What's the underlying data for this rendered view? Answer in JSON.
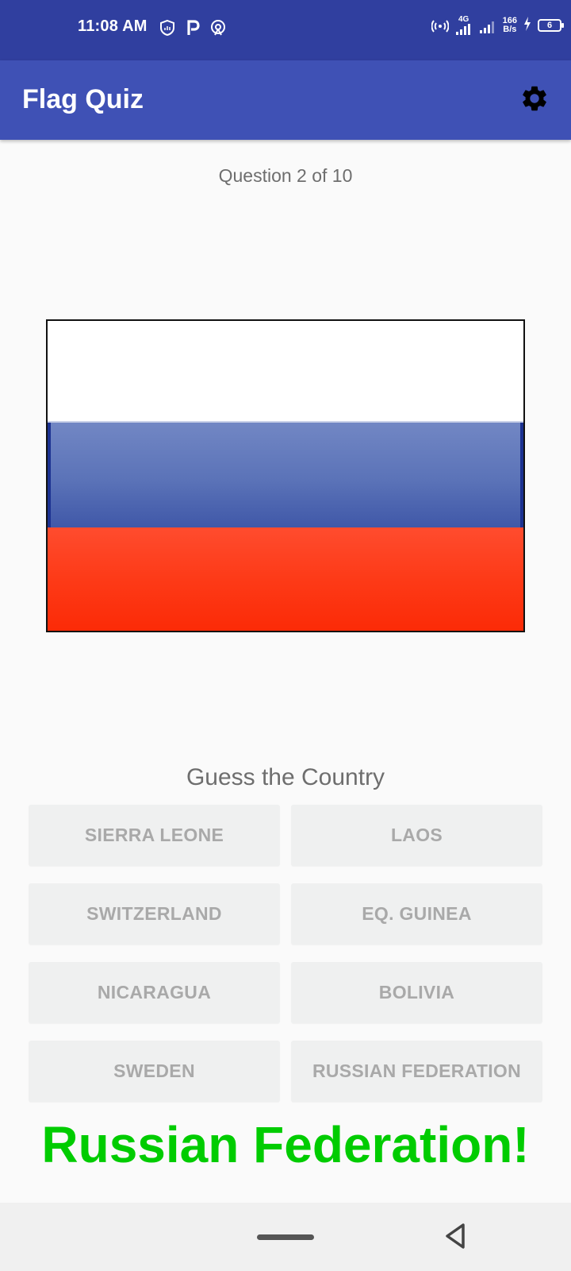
{
  "status_bar": {
    "time": "11:08 AM",
    "network_type": "4G",
    "speed_value": "166",
    "speed_unit": "B/s",
    "battery": "6",
    "icons": [
      "shield-icon",
      "p-icon",
      "hotspot-icon",
      "wifi-calling-icon",
      "signal-icon",
      "signal-icon",
      "charging-icon",
      "battery-icon"
    ]
  },
  "app_bar": {
    "title": "Flag Quiz",
    "settings_icon": "gear-icon"
  },
  "quiz": {
    "question_progress": "Question 2 of 10",
    "flag": {
      "country": "Russian Federation",
      "colors": [
        "#ffffff",
        "#5b73b8",
        "#fd3a17"
      ]
    },
    "prompt": "Guess the Country",
    "answers": [
      "SIERRA LEONE",
      "LAOS",
      "SWITZERLAND",
      "EQ. GUINEA",
      "NICARAGUA",
      "BOLIVIA",
      "SWEDEN",
      "RUSSIAN FEDERATION"
    ],
    "result": "Russian Federation!",
    "result_color": "#00cc00"
  },
  "colors": {
    "status_bar": "#303f9f",
    "app_bar": "#3f51b5",
    "button_bg": "#eff0f0",
    "button_text": "#a9a9a9"
  }
}
